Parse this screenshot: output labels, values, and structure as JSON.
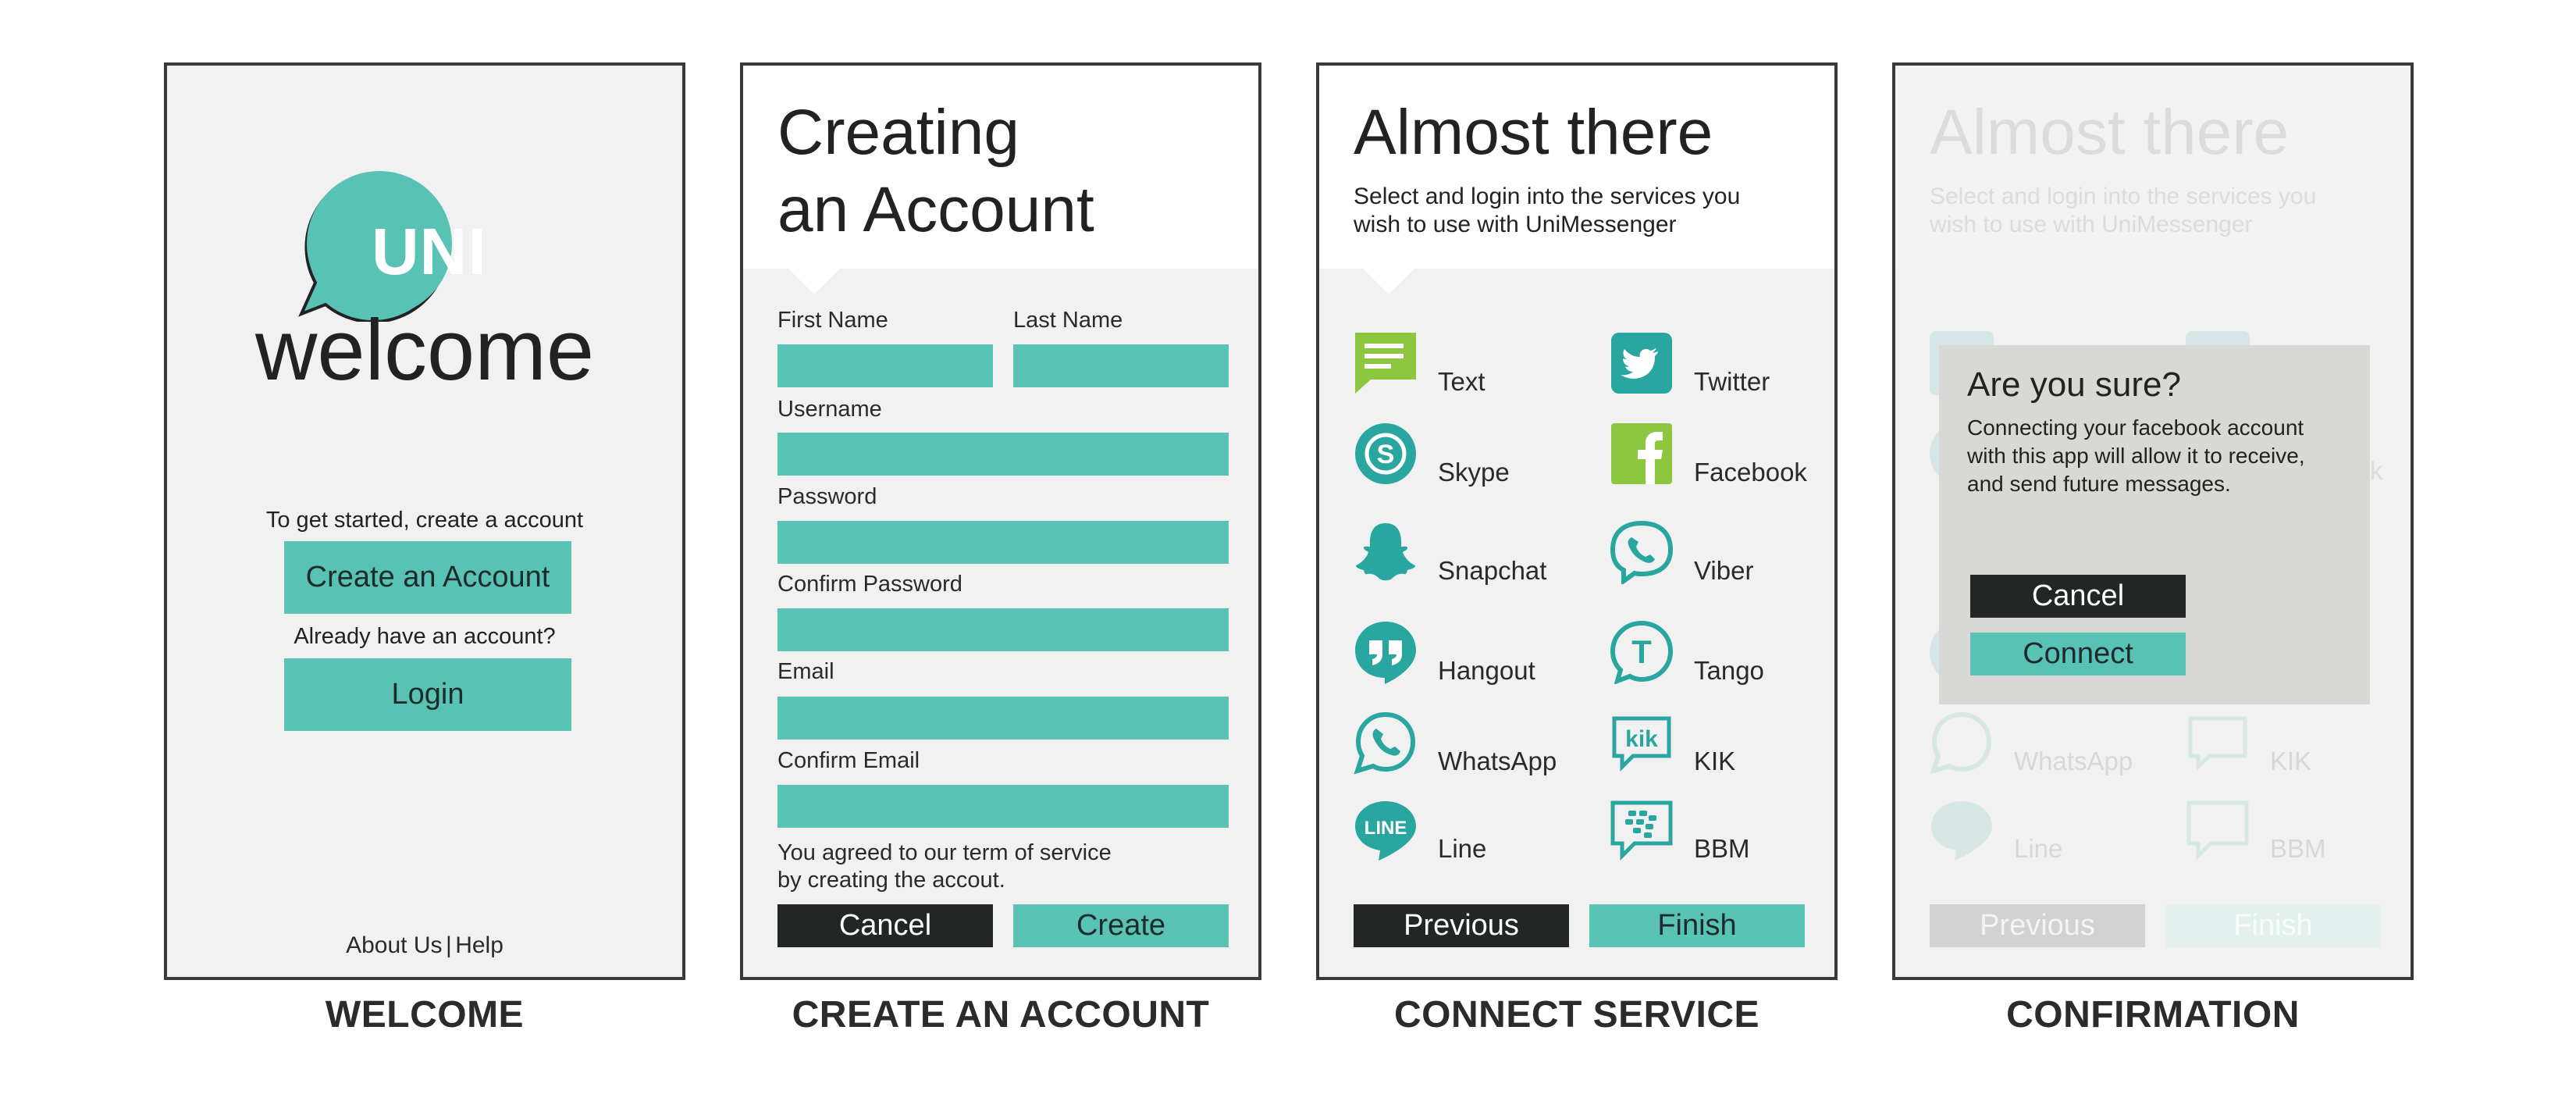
{
  "colors": {
    "teal": "#58c2b4",
    "dark": "#222624",
    "accent_icon": "#2aa6a0",
    "green_icon": "#8dc63f"
  },
  "welcome": {
    "logo_text": "UNI",
    "title": "welcome",
    "intro": "To get started, create a account",
    "create_button": "Create an Account",
    "already": "Already have an account?",
    "login_button": "Login",
    "about": "About Us",
    "separator": "|",
    "help": "Help",
    "caption": "WELCOME"
  },
  "create": {
    "title_line1": "Creating",
    "title_line2": "an Account",
    "first_name_label": "First Name",
    "last_name_label": "Last Name",
    "username_label": "Username",
    "password_label": "Password",
    "confirm_password_label": "Confirm Password",
    "email_label": "Email",
    "confirm_email_label": "Confirm Email",
    "terms_line1": "You agreed to our term of service",
    "terms_line2": "by creating the accout.",
    "cancel_button": "Cancel",
    "create_button": "Create",
    "caption": "CREATE AN ACCOUNT"
  },
  "connect": {
    "title": "Almost there",
    "subtitle_line1": "Select and login into the services you",
    "subtitle_line2": "wish to use with UniMessenger",
    "services": [
      {
        "label": "Text",
        "icon": "text-message-icon"
      },
      {
        "label": "Twitter",
        "icon": "twitter-icon"
      },
      {
        "label": "Skype",
        "icon": "skype-icon"
      },
      {
        "label": "Facebook",
        "icon": "facebook-icon"
      },
      {
        "label": "Snapchat",
        "icon": "snapchat-icon"
      },
      {
        "label": "Viber",
        "icon": "viber-icon"
      },
      {
        "label": "Hangout",
        "icon": "hangout-icon"
      },
      {
        "label": "Tango",
        "icon": "tango-icon"
      },
      {
        "label": "WhatsApp",
        "icon": "whatsapp-icon"
      },
      {
        "label": "KIK",
        "icon": "kik-icon"
      },
      {
        "label": "Line",
        "icon": "line-icon"
      },
      {
        "label": "BBM",
        "icon": "bbm-icon"
      }
    ],
    "previous_button": "Previous",
    "finish_button": "Finish",
    "caption": "CONNECT SERVICE"
  },
  "confirm": {
    "title": "Almost there",
    "subtitle_line1": "Select and login into the services you",
    "subtitle_line2": "wish to use with UniMessenger",
    "bg_whatsapp": "WhatsApp",
    "bg_kik": "KIK",
    "bg_line": "Line",
    "bg_bbm": "BBM",
    "bg_previous": "Previous",
    "bg_finish": "Finish",
    "bg_facebook_fragment": "k",
    "dialog_title": "Are you sure?",
    "dialog_line1": "Connecting your facebook account",
    "dialog_line2": "with this app will allow it to receive,",
    "dialog_line3": "and send future messages.",
    "cancel_button": "Cancel",
    "connect_button": "Connect",
    "caption": "CONFIRMATION"
  }
}
